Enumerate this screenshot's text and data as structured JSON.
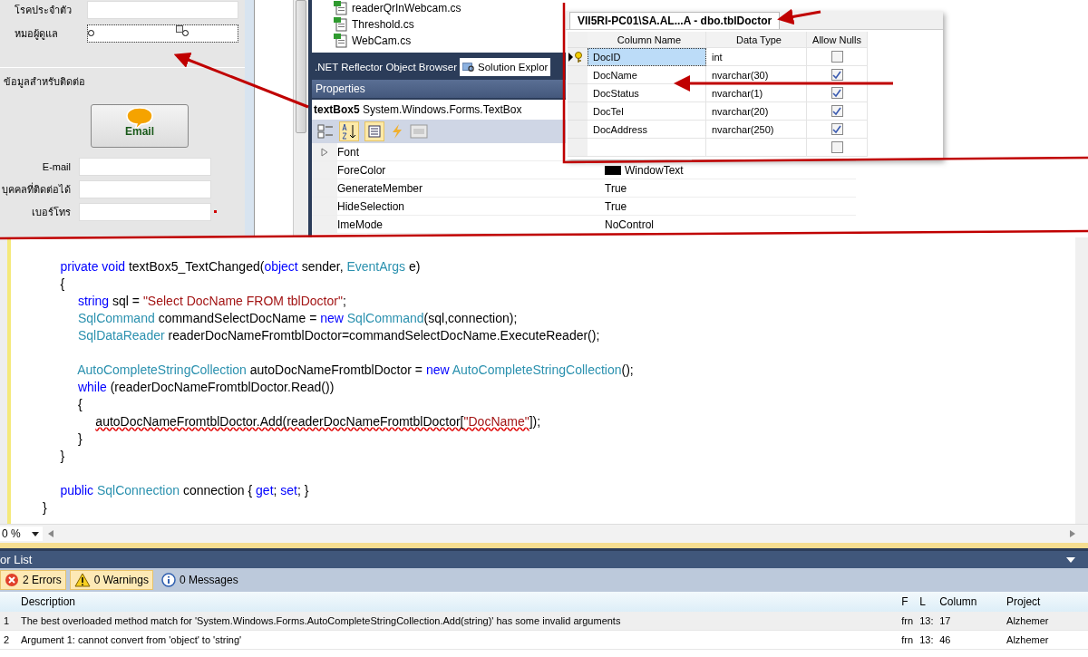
{
  "form": {
    "fields": [
      {
        "label": "โรคประจำตัว",
        "selected": false
      },
      {
        "label": "หมอผู้ดูแล",
        "selected": true
      }
    ],
    "contact_group": {
      "title": "ข้อมูลสำหรับติดต่อ",
      "email_button": "Email",
      "fields": [
        {
          "label": "E-mail",
          "required": false
        },
        {
          "label": "บุคคลที่ติดต่อได้",
          "required": false
        },
        {
          "label": "เบอร์โทร",
          "required": true
        }
      ]
    }
  },
  "solution_explorer": {
    "files": [
      "readerQrInWebcam.cs",
      "Threshold.cs",
      "WebCam.cs"
    ]
  },
  "tabs": [
    {
      "label": ".NET Reflector Object Browser",
      "selected": false
    },
    {
      "label": "Solution Explor",
      "selected": true
    }
  ],
  "properties": {
    "title": "Properties",
    "object_name": "textBox5",
    "object_type": "System.Windows.Forms.TextBox",
    "rows": [
      {
        "kind": "group",
        "name": "Font"
      },
      {
        "kind": "color",
        "name": "ForeColor",
        "value": "WindowText"
      },
      {
        "kind": "text",
        "name": "GenerateMember",
        "value": "True"
      },
      {
        "kind": "text",
        "name": "HideSelection",
        "value": "True"
      },
      {
        "kind": "text",
        "name": "ImeMode",
        "value": "NoControl"
      }
    ]
  },
  "table_designer": {
    "tab_title": "VII5RI-PC01\\SA.AL...A - dbo.tblDoctor",
    "columns": [
      "Column Name",
      "Data Type",
      "Allow Nulls"
    ],
    "rows": [
      {
        "name": "DocID",
        "type": "int",
        "allow_nulls": false,
        "selected": true,
        "primary_key": true
      },
      {
        "name": "DocName",
        "type": "nvarchar(30)",
        "allow_nulls": true,
        "selected": false,
        "primary_key": false
      },
      {
        "name": "DocStatus",
        "type": "nvarchar(1)",
        "allow_nulls": true,
        "selected": false,
        "primary_key": false
      },
      {
        "name": "DocTel",
        "type": "nvarchar(20)",
        "allow_nulls": true,
        "selected": false,
        "primary_key": false
      },
      {
        "name": "DocAddress",
        "type": "nvarchar(250)",
        "allow_nulls": true,
        "selected": false,
        "primary_key": false
      },
      {
        "allow_nulls": false,
        "selected": false,
        "primary_key": false
      }
    ]
  },
  "code": {
    "lines": [
      {
        "kind": "code",
        "tokens": [
          {
            "kind": "keyword",
            "t": "     private void",
            "squiggly": false
          },
          {
            "kind": "plain",
            "t": " textBox5_TextChanged(",
            "squiggly": false
          },
          {
            "kind": "keyword",
            "t": "object",
            "squiggly": false
          },
          {
            "kind": "plain",
            "t": " sender, ",
            "squiggly": false
          },
          {
            "kind": "type",
            "t": "EventArgs",
            "squiggly": false
          },
          {
            "kind": "plain",
            "t": " e)",
            "squiggly": false
          }
        ]
      },
      {
        "kind": "code",
        "tokens": [
          {
            "kind": "plain",
            "t": "     {",
            "squiggly": false
          }
        ]
      },
      {
        "kind": "code",
        "tokens": [
          {
            "kind": "keyword",
            "t": "          string",
            "squiggly": false
          },
          {
            "kind": "plain",
            "t": " sql = ",
            "squiggly": false
          },
          {
            "kind": "string",
            "t": "\"Select DocName FROM tblDoctor\"",
            "squiggly": false
          },
          {
            "kind": "plain",
            "t": ";",
            "squiggly": false
          }
        ]
      },
      {
        "kind": "code",
        "tokens": [
          {
            "kind": "type",
            "t": "          SqlCommand",
            "squiggly": false
          },
          {
            "kind": "plain",
            "t": " commandSelectDocName = ",
            "squiggly": false
          },
          {
            "kind": "keyword",
            "t": "new",
            "squiggly": false
          },
          {
            "kind": "type",
            "t": " SqlCommand",
            "squiggly": false
          },
          {
            "kind": "plain",
            "t": "(sql,connection);",
            "squiggly": false
          }
        ]
      },
      {
        "kind": "code",
        "tokens": [
          {
            "kind": "type",
            "t": "          SqlDataReader",
            "squiggly": false
          },
          {
            "kind": "plain",
            "t": " readerDocNameFromtblDoctor=commandSelectDocName.ExecuteReader();",
            "squiggly": false
          }
        ]
      },
      {
        "kind": "blank"
      },
      {
        "kind": "code",
        "tokens": [
          {
            "kind": "type",
            "t": "          AutoCompleteStringCollection",
            "squiggly": false
          },
          {
            "kind": "plain",
            "t": " autoDocNameFromtblDoctor = ",
            "squiggly": false
          },
          {
            "kind": "keyword",
            "t": "new",
            "squiggly": false
          },
          {
            "kind": "type",
            "t": " AutoCompleteStringCollection",
            "squiggly": false
          },
          {
            "kind": "plain",
            "t": "();",
            "squiggly": false
          }
        ]
      },
      {
        "kind": "code",
        "tokens": [
          {
            "kind": "keyword",
            "t": "          while",
            "squiggly": false
          },
          {
            "kind": "plain",
            "t": " (readerDocNameFromtblDoctor.Read())",
            "squiggly": false
          }
        ]
      },
      {
        "kind": "code",
        "tokens": [
          {
            "kind": "plain",
            "t": "          {",
            "squiggly": false
          }
        ]
      },
      {
        "kind": "code",
        "tokens": [
          {
            "kind": "plain",
            "t": "               autoDocNameFromtblDoctor.Add(readerDocNameFromtblDoctor[",
            "squiggly": true
          },
          {
            "kind": "string",
            "t": "\"DocName\"",
            "squiggly": true
          },
          {
            "kind": "plain",
            "t": "]);",
            "squiggly": false
          }
        ]
      },
      {
        "kind": "code",
        "tokens": [
          {
            "kind": "plain",
            "t": "          }",
            "squiggly": false
          }
        ]
      },
      {
        "kind": "code",
        "tokens": [
          {
            "kind": "plain",
            "t": "     }",
            "squiggly": false
          }
        ]
      },
      {
        "kind": "blank"
      },
      {
        "kind": "code",
        "tokens": [
          {
            "kind": "keyword",
            "t": "     public",
            "squiggly": false
          },
          {
            "kind": "type",
            "t": " SqlConnection",
            "squiggly": false
          },
          {
            "kind": "plain",
            "t": " connection { ",
            "squiggly": false
          },
          {
            "kind": "keyword",
            "t": "get",
            "squiggly": false
          },
          {
            "kind": "plain",
            "t": "; ",
            "squiggly": false
          },
          {
            "kind": "keyword",
            "t": "set",
            "squiggly": false
          },
          {
            "kind": "plain",
            "t": "; }",
            "squiggly": false
          }
        ]
      },
      {
        "kind": "code",
        "tokens": [
          {
            "kind": "plain",
            "t": "}",
            "squiggly": false
          }
        ]
      }
    ],
    "zoom": "0 %"
  },
  "error_list": {
    "title": "or List",
    "filters": [
      {
        "kind": "error",
        "label": "2 Errors",
        "selected": true
      },
      {
        "kind": "warning",
        "label": "0 Warnings",
        "selected": true
      },
      {
        "kind": "info",
        "label": "0 Messages",
        "selected": false
      }
    ],
    "columns": [
      "Description",
      "F",
      "L",
      "Column",
      "Project"
    ],
    "rows": [
      {
        "number": "1",
        "description": "The best overloaded method match for 'System.Windows.Forms.AutoCompleteStringCollection.Add(string)' has some invalid arguments",
        "file": "frn",
        "line": "13:",
        "column": "17",
        "project": "Alzhemer",
        "selected": true
      },
      {
        "number": "2",
        "description": "Argument 1: cannot convert from 'object' to 'string'",
        "file": "frn",
        "line": "13:",
        "column": "46",
        "project": "Alzhemer",
        "selected": false
      }
    ]
  }
}
